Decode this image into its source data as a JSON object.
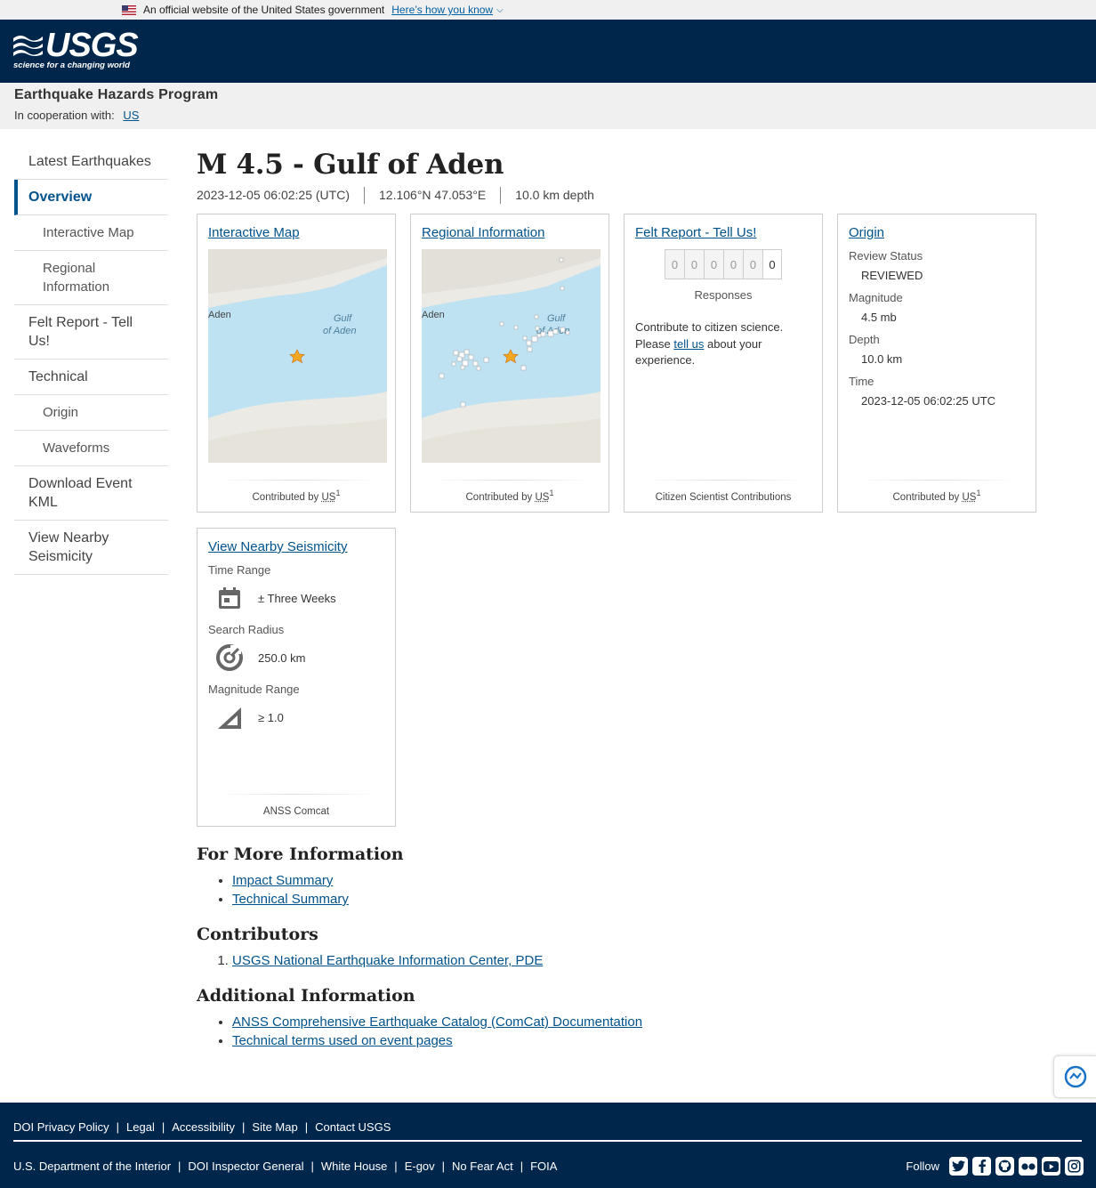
{
  "gov_banner": {
    "text": "An official website of the United States government",
    "link": "Here’s how you know"
  },
  "header": {
    "logo_word": "USGS",
    "logo_tagline": "science for a changing world"
  },
  "program": {
    "title": "Earthquake Hazards Program",
    "coop_label": "In cooperation with:",
    "coop_link": "US"
  },
  "sidebar": {
    "items": [
      {
        "label": "Latest Earthquakes"
      },
      {
        "label": "Overview"
      },
      {
        "label": "Interactive Map"
      },
      {
        "label": "Regional Information"
      },
      {
        "label": "Felt Report - Tell Us!"
      },
      {
        "label": "Technical"
      },
      {
        "label": "Origin"
      },
      {
        "label": "Waveforms"
      },
      {
        "label": "Download Event KML"
      },
      {
        "label": "View Nearby Seismicity"
      }
    ]
  },
  "event": {
    "title": "M 4.5 - Gulf of Aden",
    "time": "2023-12-05 06:02:25 (UTC)",
    "location": "12.106°N 47.053°E",
    "depth": "10.0 km depth"
  },
  "cards": {
    "interactive_map": {
      "title": "Interactive Map",
      "map_label_city": "Aden",
      "map_label_gulf_1": "Gulf",
      "map_label_gulf_2": "of Aden",
      "contrib_prefix": "Contributed by",
      "contrib_abbr": "US",
      "contrib_sup": "1"
    },
    "regional": {
      "title": "Regional Information",
      "map_label_city": "Aden",
      "map_label_gulf_1": "Gulf",
      "map_label_gulf_2": "of Aden",
      "contrib_prefix": "Contributed by",
      "contrib_abbr": "US",
      "contrib_sup": "1"
    },
    "felt": {
      "title": "Felt Report - Tell Us!",
      "digits": [
        "0",
        "0",
        "0",
        "0",
        "0",
        "0"
      ],
      "responses_label": "Responses",
      "text_1": "Contribute to citizen science. Please",
      "text_link": "tell us",
      "text_2": "about your experience.",
      "footer": "Citizen Scientist Contributions"
    },
    "origin": {
      "title": "Origin",
      "review_label": "Review Status",
      "review_value": "REVIEWED",
      "magnitude_label": "Magnitude",
      "magnitude_value": "4.5 mb",
      "depth_label": "Depth",
      "depth_value": "10.0 km",
      "time_label": "Time",
      "time_value": "2023-12-05 06:02:25 UTC",
      "contrib_prefix": "Contributed by",
      "contrib_abbr": "US",
      "contrib_sup": "1"
    },
    "nearby": {
      "title": "View Nearby Seismicity",
      "time_label": "Time Range",
      "time_value": "± Three Weeks",
      "radius_label": "Search Radius",
      "radius_value": "250.0 km",
      "magnitude_label": "Magnitude Range",
      "magnitude_value": "≥ 1.0",
      "footer": "ANSS Comcat"
    }
  },
  "more_info": {
    "heading": "For More Information",
    "links": [
      "Impact Summary",
      "Technical Summary"
    ]
  },
  "contributors": {
    "heading": "Contributors",
    "links": [
      "USGS National Earthquake Information Center, PDE"
    ]
  },
  "additional": {
    "heading": "Additional Information",
    "links": [
      "ANSS Comprehensive Earthquake Catalog (ComCat) Documentation",
      "Technical terms used on event pages"
    ]
  },
  "footer": {
    "row1": [
      "DOI Privacy Policy",
      "Legal",
      "Accessibility",
      "Site Map",
      "Contact USGS"
    ],
    "row2": [
      "U.S. Department of the Interior",
      "DOI Inspector General",
      "White House",
      "E-gov",
      "No Fear Act",
      "FOIA"
    ],
    "follow_label": "Follow",
    "social_icons": [
      "twitter-icon",
      "facebook-icon",
      "github-icon",
      "flickr-icon",
      "youtube-icon",
      "instagram-icon"
    ]
  },
  "colors": {
    "header_bg": "#00264c",
    "link": "#00528c",
    "banner_bg": "#f0f0f0",
    "star": "#f5a623"
  }
}
